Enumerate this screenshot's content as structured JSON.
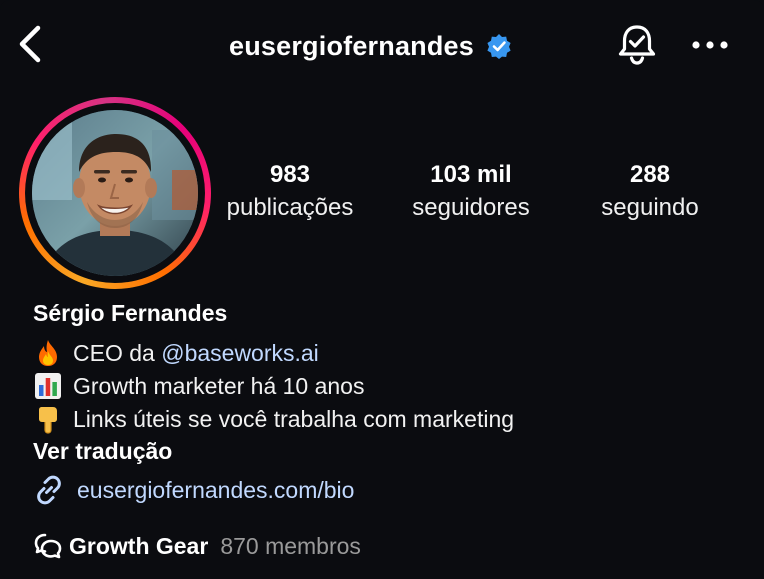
{
  "header": {
    "username": "eusergiofernandes",
    "verified": true,
    "verified_color": "#3897f0"
  },
  "stats": {
    "posts": {
      "value": "983",
      "label": "publicações"
    },
    "followers": {
      "value": "103 mil",
      "label": "seguidores"
    },
    "following": {
      "value": "288",
      "label": "seguindo"
    }
  },
  "bio": {
    "name": "Sérgio Fernandes",
    "line1": {
      "emoji": "fire-emoji",
      "text": "CEO da ",
      "mention": "@baseworks.ai"
    },
    "line2": {
      "emoji": "bar-chart-emoji",
      "text": "Growth marketer há 10 anos"
    },
    "line3": {
      "emoji": "pointing-down-emoji",
      "text": "Links úteis se você trabalha com marketing"
    },
    "translate_label": "Ver tradução",
    "link": "eusergiofernandes.com/bio",
    "link_color": "#c1d9ff"
  },
  "channel": {
    "name": "Growth Gear",
    "members": "870 membros"
  },
  "colors": {
    "background": "#0b0c10",
    "story_ring": [
      "#f9a825",
      "#ff6f00",
      "#ff1f6b",
      "#d63384"
    ]
  }
}
